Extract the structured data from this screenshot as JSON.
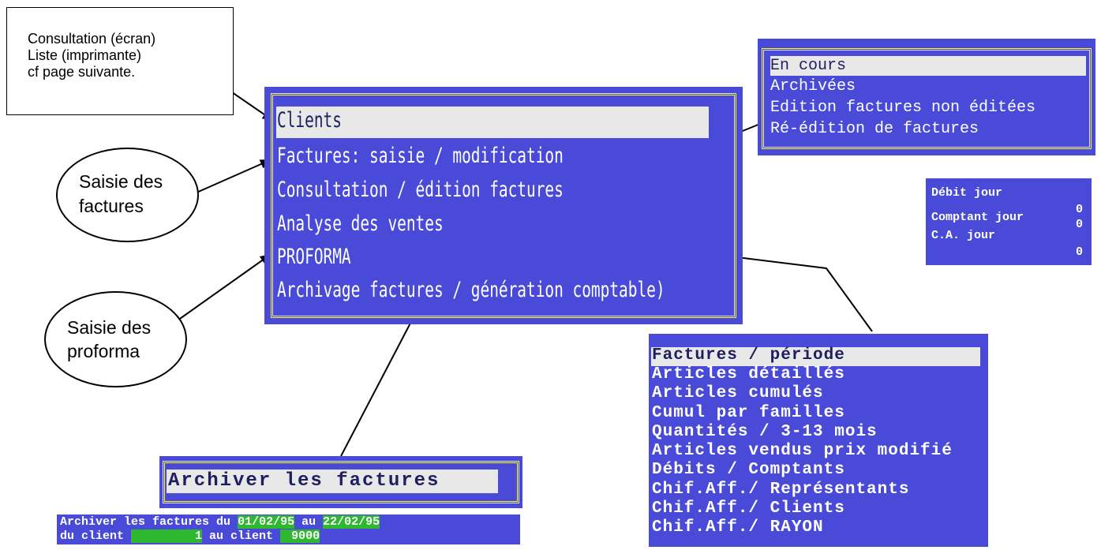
{
  "note": {
    "lines": [
      "Consultation (écran)",
      "Liste (imprimante)",
      "cf page suivante."
    ]
  },
  "bubbles": {
    "factures": [
      "Saisie des",
      "factures"
    ],
    "proforma": [
      "Saisie des",
      "proforma"
    ]
  },
  "main_menu": {
    "items": [
      "Clients",
      "Factures: saisie / modification",
      "Consultation / édition factures",
      "Analyse des ventes",
      "PROFORMA",
      "Archivage factures / génération comptable)"
    ],
    "selected_index": 0
  },
  "consultation_menu": {
    "items": [
      "En cours",
      "Archivées",
      "Edition factures non éditées",
      "Ré-édition de factures"
    ],
    "selected_index": 0
  },
  "totals": {
    "rows": [
      {
        "label": "Débit jour",
        "value": "0"
      },
      {
        "label": "Comptant jour",
        "value": "0"
      },
      {
        "label": "C.A. jour",
        "value": "0"
      }
    ]
  },
  "analyse_menu": {
    "items": [
      "Factures / période",
      "Articles détaillés",
      "Articles cumulés",
      "Cumul par familles",
      "Quantités / 3-13 mois",
      "Articles vendus prix modifié",
      "Débits / Comptants",
      "Chif.Aff./ Représentants",
      "Chif.Aff./ Clients",
      "Chif.Aff./ RAYON"
    ],
    "selected_index": 0
  },
  "archive_dialog": {
    "title": "Archiver les factures"
  },
  "archive_form": {
    "line1_prefix": "Archiver les factures du",
    "date_from": "01/02/95",
    "au_label": "au",
    "date_to": "22/02/95",
    "line2_prefix": "du client",
    "client_from": "1",
    "client_to_label": "au client",
    "client_to": "9000"
  },
  "colors": {
    "panel_blue": "#4a4ad8",
    "frame_yellow": "#f4f45a",
    "selection_grey": "#e8e8e8",
    "field_green": "#2eb830"
  }
}
